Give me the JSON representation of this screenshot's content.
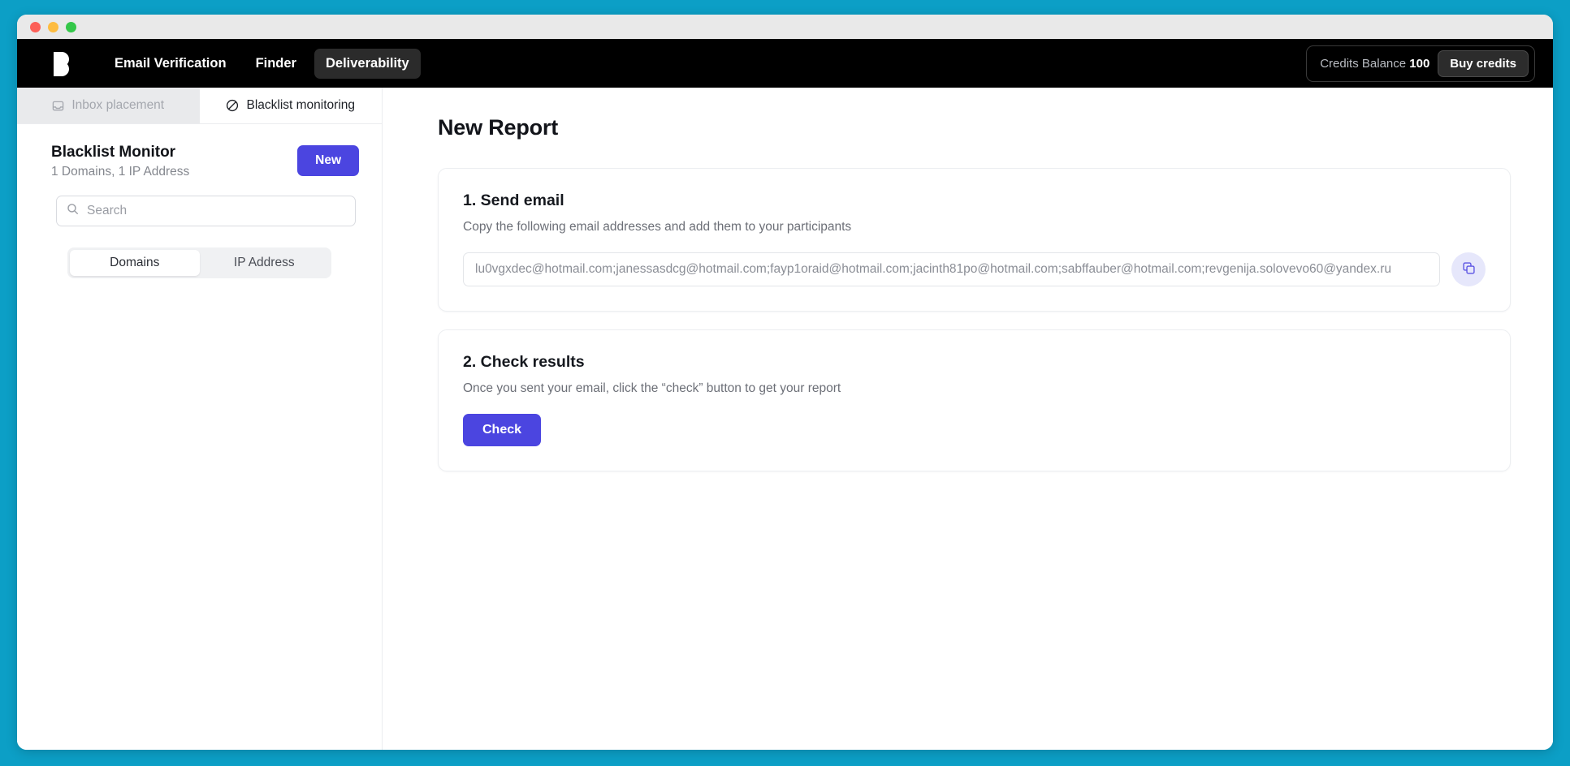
{
  "window": {
    "traffic_lights": [
      "close",
      "minimize",
      "maximize"
    ]
  },
  "topnav": {
    "logo_name": "hunter-logo",
    "links": [
      {
        "label": "Email Verification",
        "active": false
      },
      {
        "label": "Finder",
        "active": false
      },
      {
        "label": "Deliverability",
        "active": true
      }
    ],
    "credits_label": "Credits Balance",
    "credits_value": "100",
    "buy_credits_label": "Buy credits"
  },
  "sidebar": {
    "tabs": [
      {
        "label": "Inbox placement",
        "icon": "inbox-icon",
        "active": false
      },
      {
        "label": "Blacklist monitoring",
        "icon": "ban-icon",
        "active": true
      }
    ],
    "monitor_title": "Blacklist Monitor",
    "monitor_subtitle": "1 Domains, 1 IP Address",
    "new_button_label": "New",
    "search_placeholder": "Search",
    "search_value": "",
    "segmented": [
      {
        "label": "Domains",
        "active": true
      },
      {
        "label": "IP Address",
        "active": false
      }
    ]
  },
  "main": {
    "page_title": "New Report",
    "steps": [
      {
        "title": "1. Send email",
        "description": "Copy the following email addresses and add them to your participants",
        "emails_value": "lu0vgxdec@hotmail.com;janessasdcg@hotmail.com;fayp1oraid@hotmail.com;jacinth81po@hotmail.com;sabffauber@hotmail.com;revgenija.solovevo60@yandex.ru",
        "copy_icon": "copy-icon"
      },
      {
        "title": "2. Check results",
        "description": "Once you sent your email, click the “check” button to get your report",
        "button_label": "Check"
      }
    ]
  },
  "colors": {
    "desktop_background": "#0c9fc6",
    "topnav_background": "#000000",
    "accent_purple": "#4b45e0",
    "copy_button_background": "#e6e7fb",
    "inactive_tab_background": "#e9eaec"
  }
}
